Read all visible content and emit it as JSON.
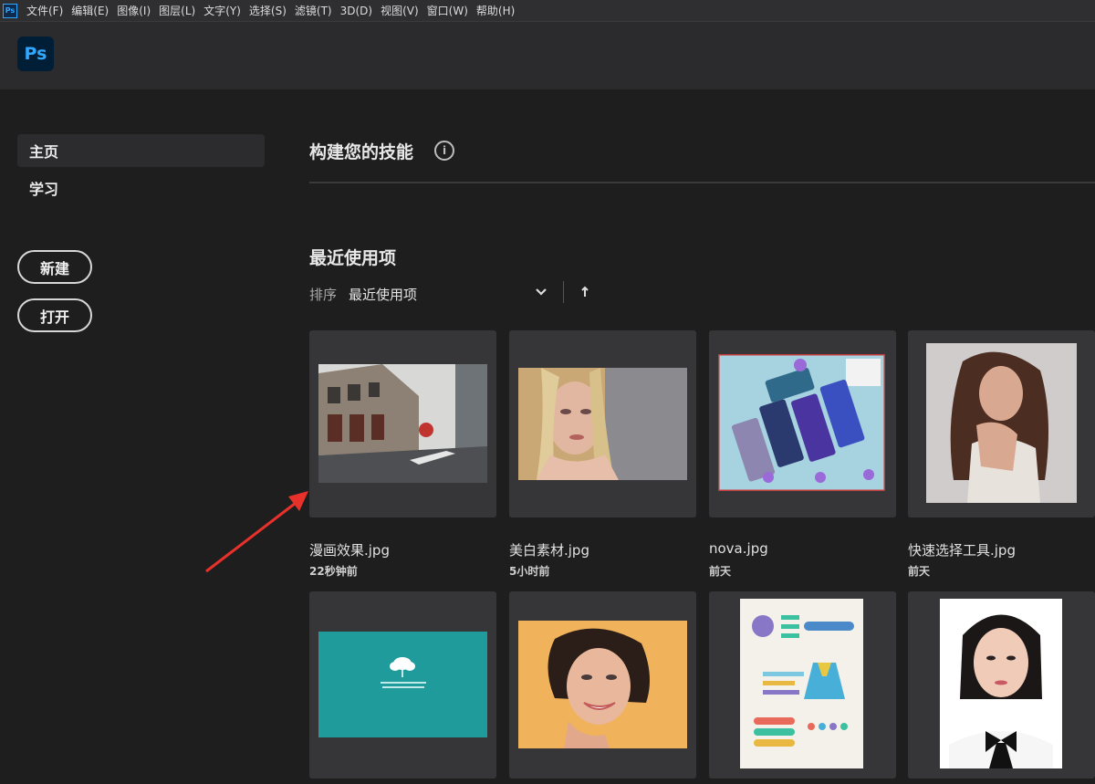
{
  "menubar": {
    "app_icon": "Ps",
    "items": [
      "文件(F)",
      "编辑(E)",
      "图像(I)",
      "图层(L)",
      "文字(Y)",
      "选择(S)",
      "滤镜(T)",
      "3D(D)",
      "视图(V)",
      "窗口(W)",
      "帮助(H)"
    ]
  },
  "header": {
    "logo": "Ps"
  },
  "sidebar": {
    "home": "主页",
    "learn": "学习",
    "new_button": "新建",
    "open_button": "打开"
  },
  "main": {
    "skills_title": "构建您的技能",
    "info_icon": "i",
    "recent_title": "最近使用项",
    "sort_label": "排序",
    "sort_value": "最近使用项"
  },
  "recent_files": [
    {
      "name": "漫画效果.jpg",
      "time": "22秒钟前"
    },
    {
      "name": "美白素材.jpg",
      "time": "5小时前"
    },
    {
      "name": "nova.jpg",
      "time": "前天"
    },
    {
      "name": "快速选择工具.jpg",
      "time": "前天"
    }
  ],
  "colors": {
    "background": "#1e1e1f",
    "card": "#363638",
    "accent": "#31a8ff",
    "annotation_arrow": "#e8312a"
  }
}
